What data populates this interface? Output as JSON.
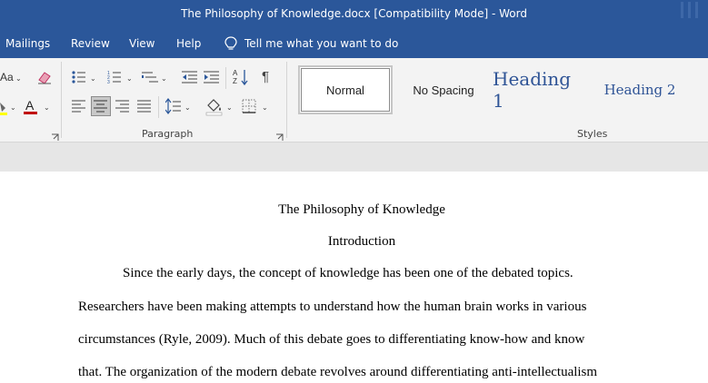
{
  "window": {
    "title": "The Philosophy of Knowledge.docx [Compatibility Mode]  -  Word"
  },
  "menu": {
    "items": [
      "Mailings",
      "Review",
      "View",
      "Help"
    ],
    "tell_me": "Tell me what you want to do"
  },
  "ribbon": {
    "groups": {
      "paragraph": "Paragraph",
      "styles": "Styles"
    },
    "font_partial": "Aa",
    "styles": {
      "normal": "Normal",
      "no_spacing": "No Spacing",
      "heading1": "Heading 1",
      "heading2": "Heading 2"
    },
    "accent_color": "#2b579a",
    "font_color": "#c00000"
  },
  "document": {
    "title": "The Philosophy of Knowledge",
    "section": "Introduction",
    "lines": [
      "Since the early days, the concept of knowledge has been one of the debated topics.",
      "Researchers have been making attempts to understand how the human brain works in various",
      "circumstances (Ryle, 2009). Much of this debate goes to differentiating know-how and know",
      "that. The organization of the modern debate revolves around differentiating anti-intellectualism"
    ]
  }
}
